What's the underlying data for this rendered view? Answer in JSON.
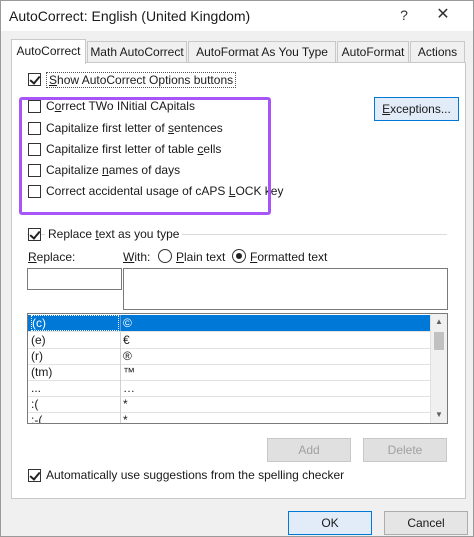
{
  "window": {
    "title": "AutoCorrect: English (United Kingdom)",
    "help_glyph": "?",
    "close_glyph": "✕"
  },
  "tabs": [
    {
      "label": "AutoCorrect",
      "active": true
    },
    {
      "label": "Math AutoCorrect",
      "active": false
    },
    {
      "label": "AutoFormat As You Type",
      "active": false
    },
    {
      "label": "AutoFormat",
      "active": false
    },
    {
      "label": "Actions",
      "active": false
    }
  ],
  "options": {
    "show_buttons": {
      "pre": "",
      "u": "S",
      "post": "how AutoCorrect Options buttons",
      "checked": true
    },
    "two_initials": {
      "pre": "C",
      "u": "o",
      "post": "rrect TWo INitial CApitals",
      "checked": false
    },
    "first_letter_sentences": {
      "pre": "Capitalize first letter of ",
      "u": "s",
      "post": "entences",
      "checked": false
    },
    "first_letter_cells": {
      "pre": "Capitalize first letter of table ",
      "u": "c",
      "post": "ells",
      "checked": false
    },
    "names_of_days": {
      "pre": "Capitalize ",
      "u": "n",
      "post": "ames of days",
      "checked": false
    },
    "caps_lock": {
      "pre": "Correct accidental usage of cAPS ",
      "u": "L",
      "post": "OCK key",
      "checked": false
    }
  },
  "exceptions_button": {
    "pre": "",
    "u": "E",
    "post": "xceptions..."
  },
  "replace_group": {
    "checkbox": {
      "pre": "Replace ",
      "u": "t",
      "post": "ext as you type",
      "checked": true
    },
    "replace_label": {
      "pre": "",
      "u": "R",
      "post": "eplace:"
    },
    "with_label": {
      "pre": "",
      "u": "W",
      "post": "ith:"
    },
    "plain_text": {
      "pre": "",
      "u": "P",
      "post": "lain text",
      "selected": false
    },
    "formatted_text": {
      "pre": "",
      "u": "F",
      "post": "ormatted text",
      "selected": true
    },
    "replace_value": "",
    "with_value": ""
  },
  "entries": [
    {
      "replace": "(c)",
      "with": "©",
      "selected": true
    },
    {
      "replace": "(e)",
      "with": "€",
      "selected": false
    },
    {
      "replace": "(r)",
      "with": "®",
      "selected": false
    },
    {
      "replace": "(tm)",
      "with": "™",
      "selected": false
    },
    {
      "replace": "...",
      "with": "…",
      "selected": false
    },
    {
      "replace": ":(",
      "with": "*",
      "selected": false
    },
    {
      "replace": ":-(",
      "with": "*",
      "selected": false
    }
  ],
  "scrollbar": {
    "up_glyph": "▲",
    "down_glyph": "▼"
  },
  "add_button": "Add",
  "delete_button": "Delete",
  "spelling_suggestions": {
    "label": "Automatically use suggestions from the spelling checker",
    "checked": true
  },
  "footer": {
    "ok": "OK",
    "cancel": "Cancel"
  },
  "colors": {
    "selection": "#0078d7",
    "highlight_box": "#a855f7"
  }
}
